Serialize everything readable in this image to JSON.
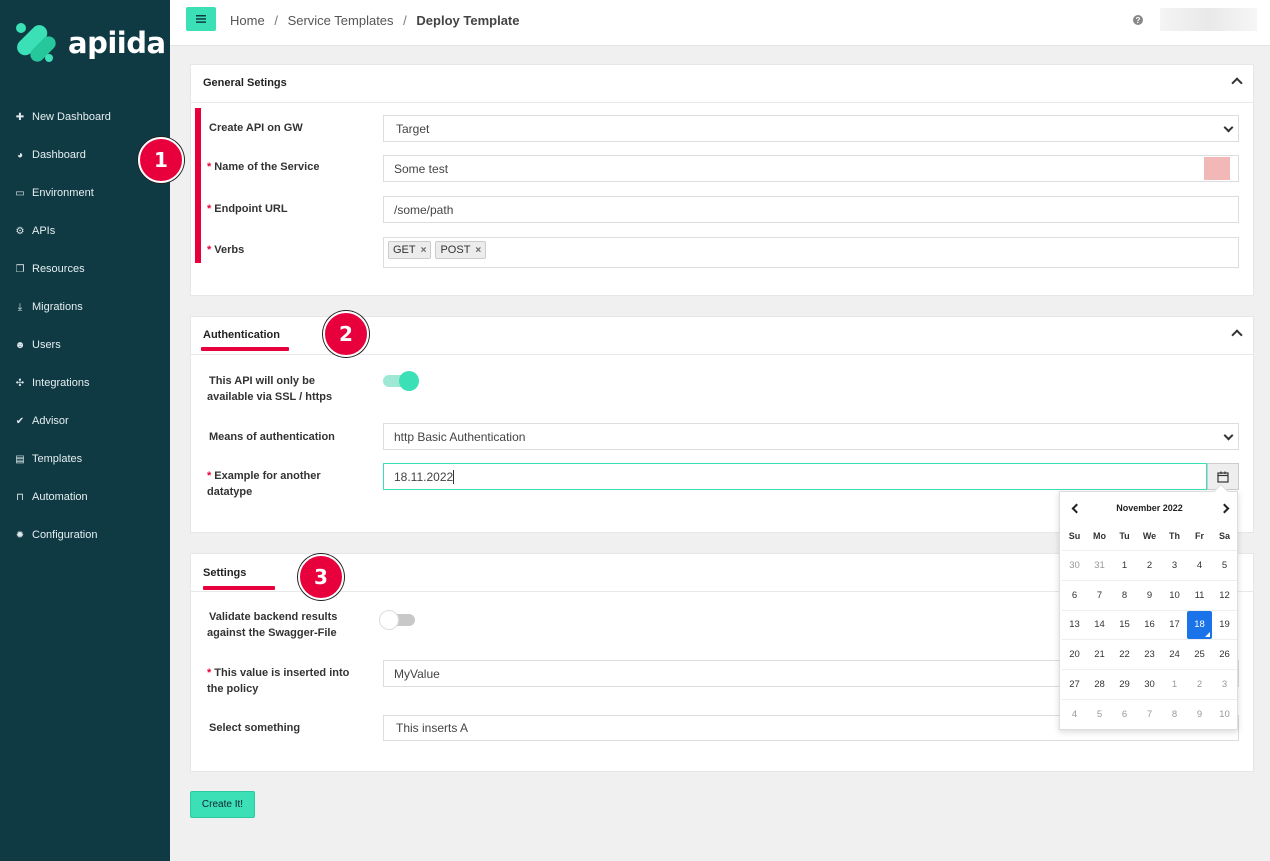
{
  "app": {
    "brand": "apiida"
  },
  "sidebar": {
    "items": [
      {
        "icon": "plus-icon",
        "label": "New Dashboard"
      },
      {
        "icon": "dashboard-icon",
        "label": "Dashboard"
      },
      {
        "icon": "monitor-icon",
        "label": "Environment"
      },
      {
        "icon": "cogs-icon",
        "label": "APIs"
      },
      {
        "icon": "copy-icon",
        "label": "Resources"
      },
      {
        "icon": "download-icon",
        "label": "Migrations"
      },
      {
        "icon": "users-icon",
        "label": "Users"
      },
      {
        "icon": "puzzle-icon",
        "label": "Integrations"
      },
      {
        "icon": "check-icon",
        "label": "Advisor"
      },
      {
        "icon": "file-icon",
        "label": "Templates"
      },
      {
        "icon": "inbox-icon",
        "label": "Automation"
      },
      {
        "icon": "gear-icon",
        "label": "Configuration"
      }
    ]
  },
  "breadcrumb": {
    "home": "Home",
    "sep1": "/",
    "parent": "Service Templates",
    "sep2": "/",
    "current": "Deploy Template"
  },
  "topbar": {
    "help": "?"
  },
  "general": {
    "title": "General Setings",
    "badge": "1",
    "create_api_label": "Create API on GW",
    "create_api_value": "Target",
    "name_label": "Name of the Service",
    "name_value": "Some test",
    "endpoint_label": "Endpoint URL",
    "endpoint_value": "/some/path",
    "verbs_label": "Verbs",
    "verbs": [
      "GET",
      "POST"
    ],
    "required_mark": "*",
    "remove_mark": "×"
  },
  "auth": {
    "title": "Authentication",
    "badge": "2",
    "ssl_label_1": "This API will only be",
    "ssl_label_2": "available via SSL / https",
    "ssl_enabled": true,
    "means_label": "Means of authentication",
    "means_value": "http Basic Authentication",
    "example_label_1": "Example for another",
    "example_label_2": "datatype",
    "example_value": "18.11.2022"
  },
  "calendar": {
    "month": "November 2022",
    "dow": [
      "Su",
      "Mo",
      "Tu",
      "We",
      "Th",
      "Fr",
      "Sa"
    ],
    "weeks": [
      [
        "30",
        "31",
        "1",
        "2",
        "3",
        "4",
        "5"
      ],
      [
        "6",
        "7",
        "8",
        "9",
        "10",
        "11",
        "12"
      ],
      [
        "13",
        "14",
        "15",
        "16",
        "17",
        "18",
        "19"
      ],
      [
        "20",
        "21",
        "22",
        "23",
        "24",
        "25",
        "26"
      ],
      [
        "27",
        "28",
        "29",
        "30",
        "1",
        "2",
        "3"
      ],
      [
        "4",
        "5",
        "6",
        "7",
        "8",
        "9",
        "10"
      ]
    ],
    "selected": "18"
  },
  "settings": {
    "title": "Settings",
    "badge": "3",
    "validate_label_1": "Validate backend results",
    "validate_label_2": "against the Swagger-File",
    "validate_enabled": false,
    "insert_label_1": "This value is inserted into",
    "insert_label_2": "the policy",
    "insert_value": "MyValue",
    "select_label": "Select something",
    "select_value": "This inserts A"
  },
  "submit_label": "Create It!",
  "colors": {
    "accent": "#3be0b6",
    "sidebar": "#0f3a44",
    "annotation": "#e8003d",
    "selected_day": "#1a73e8"
  }
}
